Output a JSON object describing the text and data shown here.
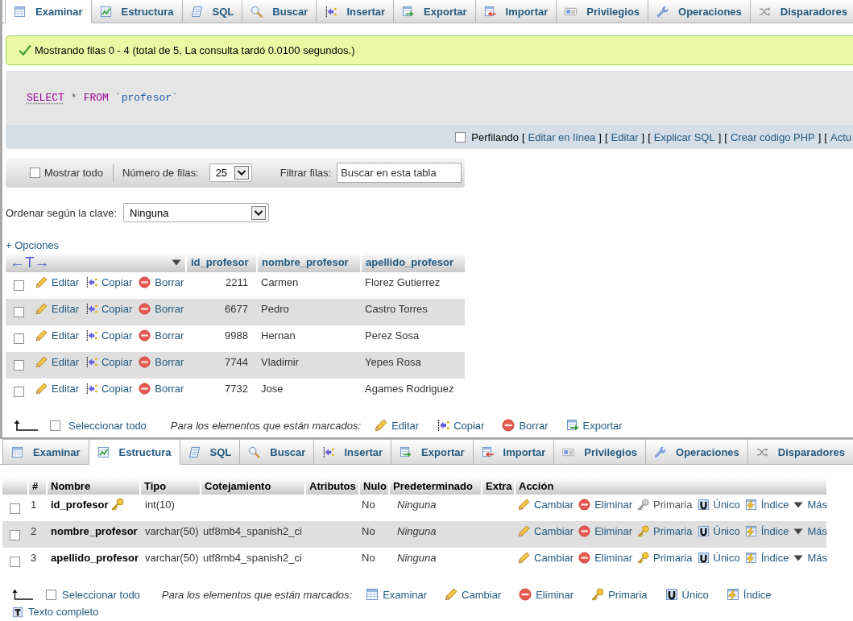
{
  "browse_view": {
    "tabs": [
      {
        "kind": "browse",
        "label": "Examinar",
        "selected": true
      },
      {
        "kind": "structure",
        "label": "Estructura",
        "selected": false
      },
      {
        "kind": "sql",
        "label": "SQL",
        "selected": false
      },
      {
        "kind": "search",
        "label": "Buscar",
        "selected": false
      },
      {
        "kind": "insert",
        "label": "Insertar",
        "selected": false
      },
      {
        "kind": "export",
        "label": "Exportar",
        "selected": false
      },
      {
        "kind": "import",
        "label": "Importar",
        "selected": false
      },
      {
        "kind": "privileges",
        "label": "Privilegios",
        "selected": false
      },
      {
        "kind": "operations",
        "label": "Operaciones",
        "selected": false
      },
      {
        "kind": "triggers",
        "label": "Disparadores",
        "selected": false
      }
    ],
    "message": "Mostrando filas 0 - 4 (total de 5, La consulta tardó 0.0100 segundos.)",
    "sql_query": [
      {
        "kind": "keyword",
        "text": "SELECT",
        "linked": true
      },
      {
        "kind": "operator",
        "text": "*",
        "linked": false
      },
      {
        "kind": "keyword",
        "text": "FROM",
        "linked": false
      },
      {
        "kind": "identifier",
        "text": "`profesor`",
        "linked": false
      }
    ],
    "query_actions": {
      "profiling": {
        "label": "Perfilando",
        "checked": false
      },
      "items": [
        {
          "kind": "bracket",
          "text": "["
        },
        {
          "kind": "link",
          "text": "Editar en línea"
        },
        {
          "kind": "bracket",
          "text": "]"
        },
        {
          "kind": "bracket",
          "text": "["
        },
        {
          "kind": "link",
          "text": "Editar"
        },
        {
          "kind": "bracket",
          "text": "]"
        },
        {
          "kind": "bracket",
          "text": "["
        },
        {
          "kind": "link",
          "text": "Explicar SQL"
        },
        {
          "kind": "bracket",
          "text": "]"
        },
        {
          "kind": "bracket",
          "text": "["
        },
        {
          "kind": "link",
          "text": "Crear código PHP"
        },
        {
          "kind": "bracket",
          "text": "]"
        },
        {
          "kind": "bracket",
          "text": "["
        },
        {
          "kind": "link",
          "text": "Actu"
        }
      ]
    },
    "navigation": {
      "show_all": {
        "label": "Mostrar todo",
        "checked": false
      },
      "rows_label": "Número de filas:",
      "rows_value": "25",
      "filter_label": "Filtrar filas:",
      "filter_placeholder": "Buscar en esta tabla"
    },
    "sort": {
      "label": "Ordenar según la clave:",
      "value": "Ninguna"
    },
    "options_link": "+ Opciones",
    "table": {
      "column_controls": [
        "←",
        "T",
        "→"
      ],
      "columns": [
        {
          "label": "id_profesor",
          "kind": "number"
        },
        {
          "label": "nombre_profesor",
          "kind": "text"
        },
        {
          "label": "apellido_profesor",
          "kind": "text"
        }
      ],
      "rows": [
        {
          "checked": false,
          "actions": [
            {
              "kind": "edit",
              "label": "Editar"
            },
            {
              "kind": "copy",
              "label": "Copiar"
            },
            {
              "kind": "delete",
              "label": "Borrar"
            }
          ],
          "cells": [
            "2211",
            "Carmen",
            "Florez Gutierrez"
          ]
        },
        {
          "checked": false,
          "actions": [
            {
              "kind": "edit",
              "label": "Editar"
            },
            {
              "kind": "copy",
              "label": "Copiar"
            },
            {
              "kind": "delete",
              "label": "Borrar"
            }
          ],
          "cells": [
            "6677",
            "Pedro",
            "Castro Torres"
          ]
        },
        {
          "checked": false,
          "actions": [
            {
              "kind": "edit",
              "label": "Editar"
            },
            {
              "kind": "copy",
              "label": "Copiar"
            },
            {
              "kind": "delete",
              "label": "Borrar"
            }
          ],
          "cells": [
            "9988",
            "Hernan",
            "Perez Sosa"
          ]
        },
        {
          "checked": false,
          "actions": [
            {
              "kind": "edit",
              "label": "Editar"
            },
            {
              "kind": "copy",
              "label": "Copiar"
            },
            {
              "kind": "delete",
              "label": "Borrar"
            }
          ],
          "cells": [
            "7744",
            "Vladimir",
            "Yepes Rosa"
          ]
        },
        {
          "checked": false,
          "actions": [
            {
              "kind": "edit",
              "label": "Editar"
            },
            {
              "kind": "copy",
              "label": "Copiar"
            },
            {
              "kind": "delete",
              "label": "Borrar"
            }
          ],
          "cells": [
            "7732",
            "Jose",
            "Agames Rodriguez"
          ]
        }
      ]
    },
    "bulk_actions": {
      "select_all": {
        "label": "Seleccionar todo",
        "checked": false
      },
      "caption": "Para los elementos que están marcados:",
      "actions": [
        {
          "kind": "edit",
          "label": "Editar"
        },
        {
          "kind": "copy",
          "label": "Copiar"
        },
        {
          "kind": "delete",
          "label": "Borrar"
        },
        {
          "kind": "export",
          "label": "Exportar"
        }
      ]
    }
  },
  "structure_view": {
    "tabs": [
      {
        "kind": "browse",
        "label": "Examinar",
        "selected": false
      },
      {
        "kind": "structure",
        "label": "Estructura",
        "selected": true
      },
      {
        "kind": "sql",
        "label": "SQL",
        "selected": false
      },
      {
        "kind": "search",
        "label": "Buscar",
        "selected": false
      },
      {
        "kind": "insert",
        "label": "Insertar",
        "selected": false
      },
      {
        "kind": "export",
        "label": "Exportar",
        "selected": false
      },
      {
        "kind": "import",
        "label": "Importar",
        "selected": false
      },
      {
        "kind": "privileges",
        "label": "Privilegios",
        "selected": false
      },
      {
        "kind": "operations",
        "label": "Operaciones",
        "selected": false
      },
      {
        "kind": "triggers",
        "label": "Disparadores",
        "selected": false
      }
    ],
    "table": {
      "columns": [
        "#",
        "Nombre",
        "Tipo",
        "Cotejamiento",
        "Atributos",
        "Nulo",
        "Predeterminado",
        "Extra",
        "Acción"
      ],
      "rows": [
        {
          "checked": false,
          "number": "1",
          "name": "id_profesor",
          "primary_key": true,
          "type": "int(10)",
          "null": "No",
          "default": "Ninguna",
          "actions": [
            {
              "kind": "change",
              "label": "Cambiar",
              "disabled": false
            },
            {
              "kind": "drop",
              "label": "Eliminar",
              "disabled": false
            },
            {
              "kind": "primary",
              "label": "Primaria",
              "disabled": true
            },
            {
              "kind": "unique",
              "label": "Único",
              "disabled": false
            },
            {
              "kind": "index",
              "label": "Índice",
              "disabled": false
            },
            {
              "kind": "more",
              "label": "Más",
              "disabled": false
            }
          ]
        },
        {
          "checked": false,
          "number": "2",
          "name": "nombre_profesor",
          "primary_key": false,
          "type": "varchar(50)",
          "collation": "utf8mb4_spanish2_ci",
          "null": "No",
          "default": "Ninguna",
          "actions": [
            {
              "kind": "change",
              "label": "Cambiar",
              "disabled": false
            },
            {
              "kind": "drop",
              "label": "Eliminar",
              "disabled": false
            },
            {
              "kind": "primary",
              "label": "Primaria",
              "disabled": false
            },
            {
              "kind": "unique",
              "label": "Único",
              "disabled": false
            },
            {
              "kind": "index",
              "label": "Índice",
              "disabled": false
            },
            {
              "kind": "more",
              "label": "Más",
              "disabled": false
            }
          ]
        },
        {
          "checked": false,
          "number": "3",
          "name": "apellido_profesor",
          "primary_key": false,
          "type": "varchar(50)",
          "collation": "utf8mb4_spanish2_ci",
          "null": "No",
          "default": "Ninguna",
          "actions": [
            {
              "kind": "change",
              "label": "Cambiar",
              "disabled": false
            },
            {
              "kind": "drop",
              "label": "Eliminar",
              "disabled": false
            },
            {
              "kind": "primary",
              "label": "Primaria",
              "disabled": false
            },
            {
              "kind": "unique",
              "label": "Único",
              "disabled": false
            },
            {
              "kind": "index",
              "label": "Índice",
              "disabled": false
            },
            {
              "kind": "more",
              "label": "Más",
              "disabled": false
            }
          ]
        }
      ]
    },
    "bulk_actions": {
      "select_all": {
        "label": "Seleccionar todo",
        "checked": false
      },
      "caption": "Para los elementos que están marcados:",
      "actions": [
        {
          "kind": "browse",
          "label": "Examinar"
        },
        {
          "kind": "change",
          "label": "Cambiar"
        },
        {
          "kind": "drop",
          "label": "Eliminar"
        },
        {
          "kind": "primary",
          "label": "Primaria"
        },
        {
          "kind": "unique",
          "label": "Único"
        },
        {
          "kind": "index",
          "label": "Índice"
        }
      ]
    },
    "full_text_link": "Texto completo"
  }
}
